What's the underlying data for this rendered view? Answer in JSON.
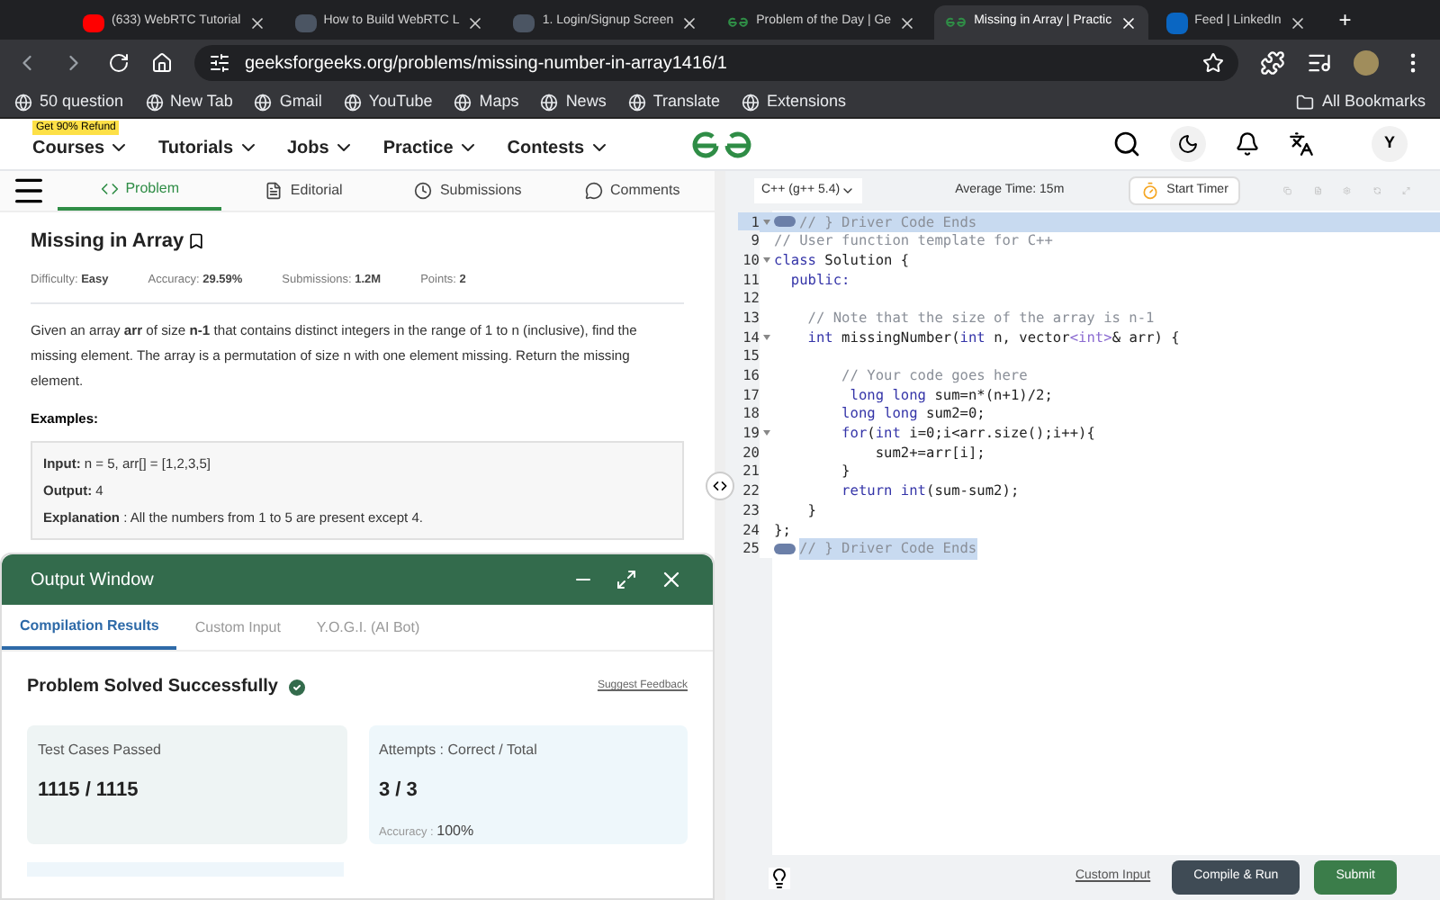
{
  "browser": {
    "tabs": [
      {
        "label": "(633) WebRTC Tutorial",
        "selected": false,
        "kind": "video"
      },
      {
        "label": "How to Build WebRTC L",
        "selected": false,
        "kind": "doc"
      },
      {
        "label": "1. Login/Signup Screen",
        "selected": false,
        "kind": "doc"
      },
      {
        "label": "Problem of the Day | Ge",
        "selected": false,
        "kind": "gfg"
      },
      {
        "label": "Missing in Array | Practic",
        "selected": true,
        "kind": "gfg"
      },
      {
        "label": "Feed | LinkedIn",
        "selected": false,
        "kind": "in"
      }
    ],
    "new_tab": "+",
    "url": "geeksforgeeks.org/problems/missing-number-in-array1416/1",
    "bookmarks": [
      "50 question",
      "New Tab",
      "Gmail",
      "YouTube",
      "Maps",
      "News",
      "Translate",
      "Extensions"
    ],
    "all_bookmarks": "All Bookmarks"
  },
  "site_nav": {
    "badge": "Get 90% Refund",
    "menus": [
      "Courses",
      "Tutorials",
      "Jobs",
      "Practice",
      "Contests"
    ],
    "avatar": "Y"
  },
  "problem_tabs": [
    {
      "label": "Problem",
      "selected": true
    },
    {
      "label": "Editorial",
      "selected": false
    },
    {
      "label": "Submissions",
      "selected": false
    },
    {
      "label": "Comments",
      "selected": false
    }
  ],
  "problem": {
    "title": "Missing in Array",
    "meta": [
      {
        "label": "Difficulty:",
        "value": "Easy"
      },
      {
        "label": "Accuracy:",
        "value": "29.59%"
      },
      {
        "label": "Submissions:",
        "value": "1.2M"
      },
      {
        "label": "Points:",
        "value": "2"
      }
    ],
    "description": "Given an array **arr** of size **n-1** that contains distinct integers in the range of 1 to n (inclusive), find the missing element. The array is a permutation of size n with one element missing. Return the missing element.",
    "examples_heading": "Examples:",
    "example": [
      {
        "label": "Input:",
        "text": "n = 5, arr[] = [1,2,3,5]"
      },
      {
        "label": "Output:",
        "text": "4"
      },
      {
        "label": "Explanation",
        "text": ": All the numbers from 1 to 5 are present except 4."
      }
    ]
  },
  "output_window": {
    "title": "Output Window",
    "tabs": [
      {
        "label": "Compilation Results",
        "selected": true
      },
      {
        "label": "Custom Input",
        "selected": false
      },
      {
        "label": "Y.O.G.I. (AI Bot)",
        "selected": false
      }
    ],
    "status": "Problem Solved Successfully",
    "feedback": "Suggest Feedback",
    "cards": [
      {
        "label": "Test Cases Passed",
        "value": "1115 / 1115"
      },
      {
        "label": "Attempts : Correct / Total",
        "value": "3 / 3",
        "sub_label": "Accuracy :",
        "sub_value": "100%"
      }
    ]
  },
  "editor": {
    "language": "C++ (g++ 5.4)",
    "average_time": "Average Time: 15m",
    "timer": "Start Timer",
    "lines": [
      {
        "number": "1",
        "foldable": true,
        "collapsed": true,
        "active": true,
        "selected": false,
        "tokens": [
          {
            "kind": "comment",
            "text": "// } Driver Code Ends"
          }
        ]
      },
      {
        "number": "9",
        "foldable": false,
        "collapsed": false,
        "active": false,
        "selected": false,
        "tokens": [
          {
            "kind": "comment",
            "text": "// User function template for C++"
          }
        ]
      },
      {
        "number": "10",
        "foldable": true,
        "collapsed": false,
        "active": false,
        "selected": false,
        "tokens": [
          {
            "kind": "keyword",
            "text": "class"
          },
          {
            "kind": "plain",
            "text": " Solution {"
          }
        ]
      },
      {
        "number": "11",
        "foldable": false,
        "collapsed": false,
        "active": false,
        "selected": false,
        "tokens": [
          {
            "kind": "keyword",
            "text": "  public:"
          }
        ]
      },
      {
        "number": "12",
        "foldable": false,
        "collapsed": false,
        "active": false,
        "selected": false
      },
      {
        "number": "13",
        "foldable": false,
        "collapsed": false,
        "active": false,
        "selected": false,
        "tokens": [
          {
            "kind": "comment",
            "text": "    // Note that the size of the array is n-1"
          }
        ]
      },
      {
        "number": "14",
        "foldable": true,
        "collapsed": false,
        "active": false,
        "selected": false,
        "tokens": [
          {
            "kind": "keyword",
            "text": "    int"
          },
          {
            "kind": "plain",
            "text": " missingNumber("
          },
          {
            "kind": "keyword",
            "text": "int"
          },
          {
            "kind": "plain",
            "text": " n, vector"
          },
          {
            "kind": "type",
            "text": "<int>"
          },
          {
            "kind": "plain",
            "text": "& arr) {"
          }
        ]
      },
      {
        "number": "15",
        "foldable": false,
        "collapsed": false,
        "active": false,
        "selected": false
      },
      {
        "number": "16",
        "foldable": false,
        "collapsed": false,
        "active": false,
        "selected": false,
        "tokens": [
          {
            "kind": "comment",
            "text": "        // Your code goes here"
          }
        ]
      },
      {
        "number": "17",
        "foldable": false,
        "collapsed": false,
        "active": false,
        "selected": false,
        "tokens": [
          {
            "kind": "keyword",
            "text": "         long long"
          },
          {
            "kind": "plain",
            "text": " sum=n*(n+1)/2;"
          }
        ]
      },
      {
        "number": "18",
        "foldable": false,
        "collapsed": false,
        "active": false,
        "selected": false,
        "tokens": [
          {
            "kind": "keyword",
            "text": "        long long"
          },
          {
            "kind": "plain",
            "text": " sum2=0;"
          }
        ]
      },
      {
        "number": "19",
        "foldable": true,
        "collapsed": false,
        "active": false,
        "selected": false,
        "tokens": [
          {
            "kind": "keyword",
            "text": "        for"
          },
          {
            "kind": "plain",
            "text": "("
          },
          {
            "kind": "keyword",
            "text": "int"
          },
          {
            "kind": "plain",
            "text": " i=0;i<arr.size();i++){"
          }
        ]
      },
      {
        "number": "20",
        "foldable": false,
        "collapsed": false,
        "active": false,
        "selected": false,
        "tokens": [
          {
            "kind": "plain",
            "text": "            sum2+=arr[i];"
          }
        ]
      },
      {
        "number": "21",
        "foldable": false,
        "collapsed": false,
        "active": false,
        "selected": false,
        "tokens": [
          {
            "kind": "plain",
            "text": "        }"
          }
        ]
      },
      {
        "number": "22",
        "foldable": false,
        "collapsed": false,
        "active": false,
        "selected": false,
        "tokens": [
          {
            "kind": "keyword",
            "text": "        return int"
          },
          {
            "kind": "plain",
            "text": "(sum-sum2);"
          }
        ]
      },
      {
        "number": "23",
        "foldable": false,
        "collapsed": false,
        "active": false,
        "selected": false,
        "tokens": [
          {
            "kind": "plain",
            "text": "    }"
          }
        ]
      },
      {
        "number": "24",
        "foldable": false,
        "collapsed": false,
        "active": false,
        "selected": false,
        "tokens": [
          {
            "kind": "plain",
            "text": "};"
          }
        ]
      },
      {
        "number": "25",
        "foldable": false,
        "collapsed": true,
        "active": false,
        "selected": true,
        "tokens": [
          {
            "kind": "comment",
            "text": "// } Driver Code Ends"
          }
        ]
      }
    ]
  },
  "footer": {
    "custom_input": "Custom Input",
    "compile": "Compile & Run",
    "submit": "Submit"
  }
}
